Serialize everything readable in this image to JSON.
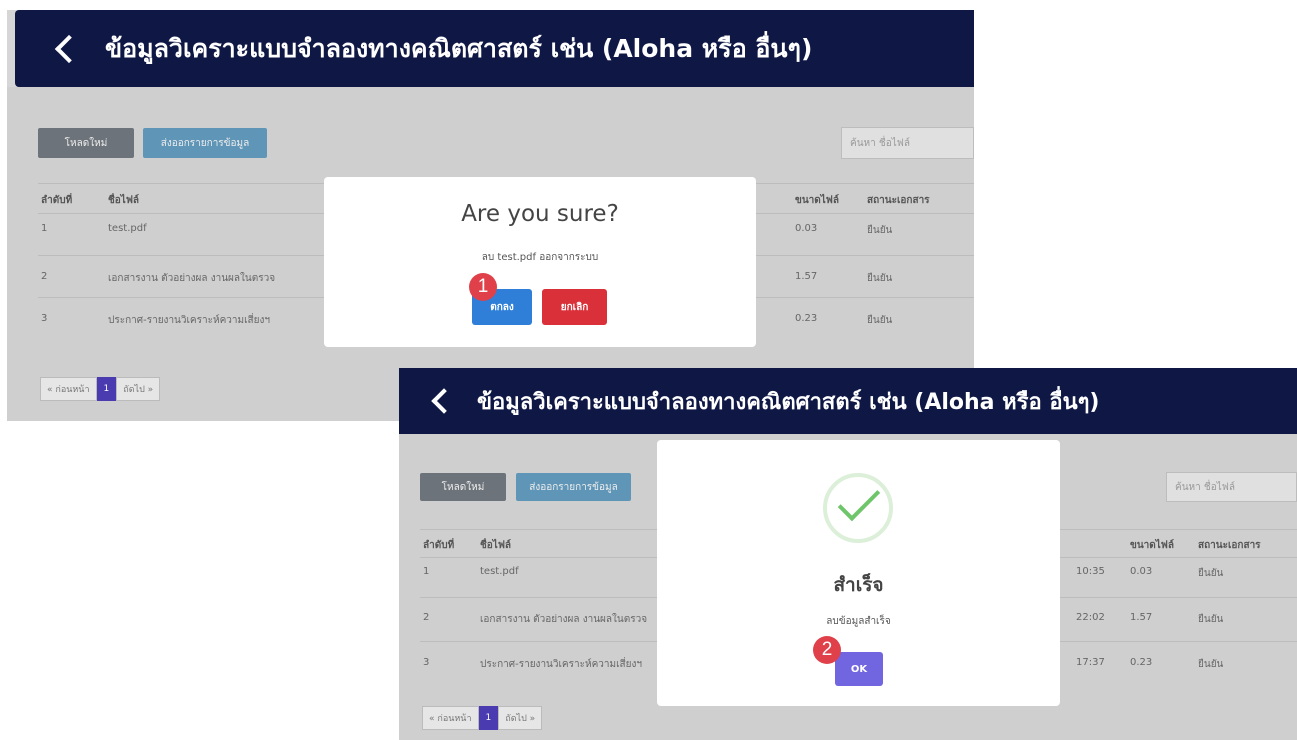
{
  "page_title": "ข้อมูลวิเคราะแบบจำลองทางคณิตศาสตร์ เช่น (Aloha หรือ อื่นๆ)",
  "toolbar": {
    "reload_label": "โหลดใหม่",
    "export_label": "ส่งออกรายการข้อมูล",
    "search_placeholder": "ค้นหา ชื่อไฟล์"
  },
  "table": {
    "columns": [
      "ลำดับที่",
      "ชื่อไฟล์",
      "ขนาดไฟล์",
      "สถานะเอกสาร"
    ],
    "rows": [
      {
        "no": "1",
        "name": "test.pdf",
        "time": "10:35",
        "size": "0.03",
        "status": "ยืนยัน"
      },
      {
        "no": "2",
        "name": "เอกสารงาน ตัวอย่างผล งานผลในตรวจ",
        "time": "22:02",
        "size": "1.57",
        "status": "ยืนยัน"
      },
      {
        "no": "3",
        "name": "ประกาศ-รายงานวิเคราะห์ความเสี่ยงฯ",
        "time": "17:37",
        "size": "0.23",
        "status": "ยืนยัน"
      }
    ]
  },
  "pager": {
    "prev": "« ก่อนหน้า",
    "current": "1",
    "next": "ถัดไป »"
  },
  "confirm_dialog": {
    "title": "Are you sure?",
    "text": "ลบ test.pdf ออกจากระบบ",
    "ok_label": "ตกลง",
    "cancel_label": "ยกเลิก",
    "step": "1"
  },
  "success_dialog": {
    "title": "สำเร็จ",
    "text": "ลบข้อมูลสำเร็จ",
    "ok_label": "OK",
    "step": "2",
    "icon": "check-circle-icon"
  },
  "colors": {
    "header_bg": "#0f1845",
    "ok_blue": "#2f7fd8",
    "cancel_red": "#d9303a",
    "ok_purple": "#7166e0",
    "step_badge": "#e0404a",
    "success_green": "#6fc56a"
  }
}
